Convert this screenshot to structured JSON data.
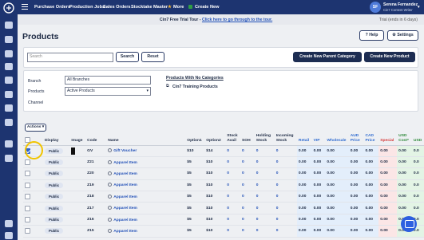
{
  "topbar": {
    "nav": [
      "Purchase Orders",
      "Production Jobs",
      "Sales Orders",
      "Stocktake Master",
      "More",
      "Create New"
    ],
    "user_initials": "SF",
    "user_name": "Serena Fernandez",
    "user_role": "Cin7 Content Writer"
  },
  "banner": {
    "lead": "Cin7 Free Trial Tour - ",
    "link": "Click here to go through to the tour.",
    "trial": "Trial (ends in 6 days)"
  },
  "page": {
    "title": "Products",
    "help": "Help",
    "settings": "Settings"
  },
  "search": {
    "placeholder": "Search",
    "search_btn": "Search",
    "reset_btn": "Reset",
    "new_parent_btn": "Create New Parent Category",
    "new_product_btn": "Create New Product"
  },
  "filters": {
    "branch_label": "Branch",
    "branch_value": "All Branches",
    "products_label": "Products",
    "products_value": "Active Products",
    "channel_label": "Channel",
    "link_no_categories": "Products With No Categories",
    "link_training": "Cin7 Training Products"
  },
  "table": {
    "actions": "Actions",
    "headers": [
      "Display",
      "Image",
      "Code",
      "Name",
      "Option1",
      "Option2",
      "Stock Avail",
      "SOH",
      "Holding Stock",
      "Incoming Stock",
      "Retail",
      "VIP",
      "Wholesale",
      "AUD Price",
      "CAD Price",
      "Special",
      "USD Cost*",
      "USD"
    ],
    "rows": [
      {
        "checked": true,
        "display": "Public",
        "image": true,
        "code": "GV",
        "name": "Gift Voucher",
        "opt1": "$10",
        "opt2": "$14",
        "avail": "0",
        "soh": "0",
        "hold": "0",
        "inc": "0",
        "retail": "0.00",
        "vip": "0.00",
        "whole": "0.00",
        "aud": "0.00",
        "cad": "0.00",
        "special": "0.00",
        "usdcost": "0.00",
        "usd": "0.0"
      },
      {
        "checked": false,
        "display": "Public",
        "image": false,
        "code": "Z21",
        "name": "Apparel Item",
        "opt1": "$5",
        "opt2": "$10",
        "avail": "0",
        "soh": "0",
        "hold": "0",
        "inc": "0",
        "retail": "0.00",
        "vip": "0.00",
        "whole": "0.00",
        "aud": "0.00",
        "cad": "0.00",
        "special": "0.00",
        "usdcost": "0.00",
        "usd": "0.0"
      },
      {
        "checked": false,
        "display": "Public",
        "image": false,
        "code": "Z20",
        "name": "Apparel Item",
        "opt1": "$5",
        "opt2": "$10",
        "avail": "0",
        "soh": "0",
        "hold": "0",
        "inc": "0",
        "retail": "0.00",
        "vip": "0.00",
        "whole": "0.00",
        "aud": "0.00",
        "cad": "0.00",
        "special": "0.00",
        "usdcost": "0.00",
        "usd": "0.0"
      },
      {
        "checked": false,
        "display": "Public",
        "image": false,
        "code": "Z19",
        "name": "Apparel Item",
        "opt1": "$5",
        "opt2": "$10",
        "avail": "0",
        "soh": "0",
        "hold": "0",
        "inc": "0",
        "retail": "0.00",
        "vip": "0.00",
        "whole": "0.00",
        "aud": "0.00",
        "cad": "0.00",
        "special": "0.00",
        "usdcost": "0.00",
        "usd": "0.0"
      },
      {
        "checked": false,
        "display": "Public",
        "image": false,
        "code": "Z18",
        "name": "Apparel Item",
        "opt1": "$5",
        "opt2": "$10",
        "avail": "0",
        "soh": "0",
        "hold": "0",
        "inc": "0",
        "retail": "0.00",
        "vip": "0.00",
        "whole": "0.00",
        "aud": "0.00",
        "cad": "0.00",
        "special": "0.00",
        "usdcost": "0.00",
        "usd": "0.0"
      },
      {
        "checked": false,
        "display": "Public",
        "image": false,
        "code": "Z17",
        "name": "Apparel Item",
        "opt1": "$5",
        "opt2": "$10",
        "avail": "0",
        "soh": "0",
        "hold": "0",
        "inc": "0",
        "retail": "0.00",
        "vip": "0.00",
        "whole": "0.00",
        "aud": "0.00",
        "cad": "0.00",
        "special": "0.00",
        "usdcost": "0.00",
        "usd": "0.0"
      },
      {
        "checked": false,
        "display": "Public",
        "image": false,
        "code": "Z16",
        "name": "Apparel Item",
        "opt1": "$5",
        "opt2": "$10",
        "avail": "0",
        "soh": "0",
        "hold": "0",
        "inc": "0",
        "retail": "0.00",
        "vip": "0.00",
        "whole": "0.00",
        "aud": "0.00",
        "cad": "0.00",
        "special": "0.00",
        "usdcost": "0.00",
        "usd": "0.0"
      },
      {
        "checked": false,
        "display": "Public",
        "image": false,
        "code": "Z15",
        "name": "Apparel Item",
        "opt1": "$5",
        "opt2": "$10",
        "avail": "0",
        "soh": "0",
        "hold": "0",
        "inc": "0",
        "retail": "0.00",
        "vip": "0.00",
        "whole": "0.00",
        "aud": "0.00",
        "cad": "0.00",
        "special": "0.00",
        "usdcost": "0.00",
        "usd": "0.0"
      }
    ]
  },
  "colors": {
    "nav": "#1d3470",
    "accent": "#2f64d1",
    "highlight": "#f0c400"
  }
}
